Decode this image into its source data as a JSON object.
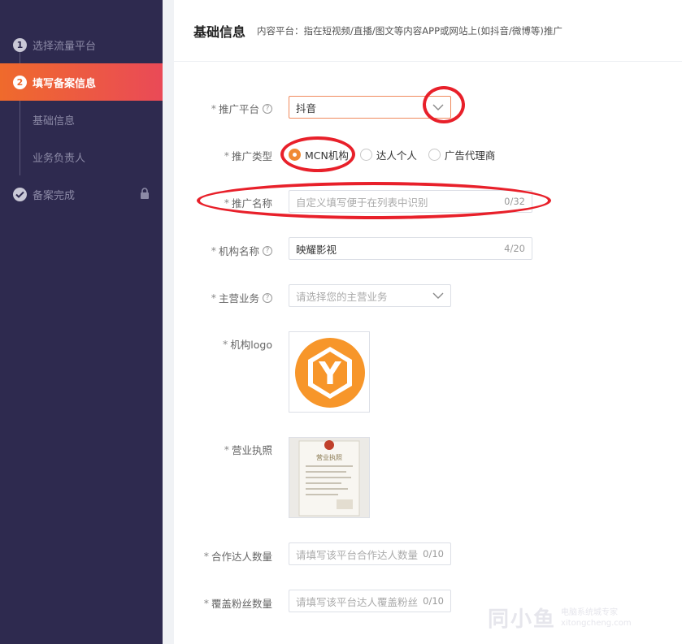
{
  "sidebar": {
    "steps": [
      {
        "num": "1",
        "label": "选择流量平台"
      },
      {
        "num": "2",
        "label": "填写备案信息"
      },
      {
        "label": "基础信息"
      },
      {
        "label": "业务负责人"
      },
      {
        "label": "备案完成"
      }
    ],
    "icons": {
      "check": "check-icon",
      "lock": "lock-icon"
    }
  },
  "header": {
    "title": "基础信息",
    "desc": "内容平台：指在短视频/直播/图文等内容APP或网站上(如抖音/微博等)推广"
  },
  "form": {
    "platform": {
      "star": "*",
      "label": "推广平台",
      "value": "抖音"
    },
    "type": {
      "star": "*",
      "label": "推广类型",
      "options": [
        "MCN机构",
        "达人个人",
        "广告代理商"
      ],
      "selected": "MCN机构"
    },
    "name": {
      "star": "*",
      "label": "推广名称",
      "placeholder": "自定义填写便于在列表中识别",
      "count": "0/32"
    },
    "org": {
      "star": "*",
      "label": "机构名称",
      "value": "映耀影视",
      "count": "4/20"
    },
    "business": {
      "star": "*",
      "label": "主营业务",
      "placeholder": "请选择您的主营业务"
    },
    "logo": {
      "star": "*",
      "label": "机构logo",
      "letter": "Y"
    },
    "license": {
      "star": "*",
      "label": "营业执照",
      "doc_title": "营业执照"
    },
    "cooperators": {
      "star": "*",
      "label": "合作达人数量",
      "placeholder": "请填写该平台合作达人数量",
      "count": "0/10"
    },
    "fans": {
      "star": "*",
      "label": "覆盖粉丝数量",
      "placeholder": "请填写该平台达人覆盖粉丝数量",
      "count": "0/10"
    },
    "help_glyph": "?"
  },
  "colors": {
    "sidebar_bg": "#2e2a4f",
    "active_gradient_start": "#ef6a2c",
    "active_gradient_end": "#ea4a57",
    "radio_selected": "#f08a33",
    "logo_orange": "#f7962a",
    "annotation_red": "#e8202a"
  },
  "watermark": {
    "main": "同小鱼",
    "line1": "电脑系统城专家",
    "line2": "xitongcheng.com"
  }
}
